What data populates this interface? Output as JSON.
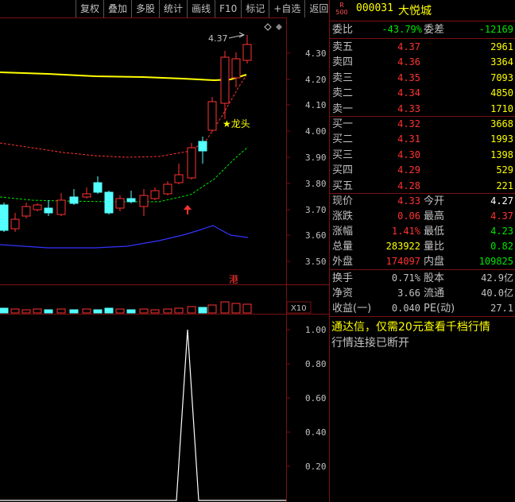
{
  "toolbar": [
    "复权",
    "叠加",
    "多股",
    "统计",
    "画线",
    "F10",
    "标记",
    "+自选",
    "返回"
  ],
  "chart": {
    "price_axis": [
      "4.30",
      "4.20",
      "4.10",
      "4.00",
      "3.90",
      "3.80",
      "3.70",
      "3.60",
      "3.50"
    ],
    "indicator_axis": [
      "1.00",
      "0.80",
      "0.60",
      "0.40",
      "0.20"
    ],
    "high_label": "4.37",
    "dragon_label": "★龙头",
    "hk_badge": "港",
    "volume_tag": "X10",
    "colors": {
      "up": "#ff3232",
      "down": "#54ffff",
      "ma_yellow": "#ffff00",
      "axis": "#7a1010"
    }
  },
  "stock": {
    "badge_r": "R",
    "badge_num": "500",
    "code": "000031",
    "name": "大悦城"
  },
  "order_book": {
    "weibi_label": "委比",
    "weibi_value": "-43.79%",
    "weicha_label": "委差",
    "weicha_value": "-12169",
    "sell": [
      {
        "label": "卖五",
        "price": "4.37",
        "volume": "2961"
      },
      {
        "label": "卖四",
        "price": "4.36",
        "volume": "3364"
      },
      {
        "label": "卖三",
        "price": "4.35",
        "volume": "7093"
      },
      {
        "label": "卖二",
        "price": "4.34",
        "volume": "4850"
      },
      {
        "label": "卖一",
        "price": "4.33",
        "volume": "1710"
      }
    ],
    "buy": [
      {
        "label": "买一",
        "price": "4.32",
        "volume": "3668"
      },
      {
        "label": "买二",
        "price": "4.31",
        "volume": "1993"
      },
      {
        "label": "买三",
        "price": "4.30",
        "volume": "1398"
      },
      {
        "label": "买四",
        "price": "4.29",
        "volume": "529"
      },
      {
        "label": "买五",
        "price": "4.28",
        "volume": "221"
      }
    ]
  },
  "quote": {
    "xianjia_label": "现价",
    "xianjia": "4.33",
    "jinkai_label": "今开",
    "jinkai": "4.27",
    "zhangdie_label": "涨跌",
    "zhangdie": "0.06",
    "zuigao_label": "最高",
    "zuigao": "4.37",
    "zhangfu_label": "涨幅",
    "zhangfu": "1.41%",
    "zuidi_label": "最低",
    "zuidi": "4.23",
    "zongliang_label": "总量",
    "zongliang": "283922",
    "liangbi_label": "量比",
    "liangbi": "0.82",
    "waipan_label": "外盘",
    "waipan": "174097",
    "neipan_label": "内盘",
    "neipan": "109825",
    "huanshou_label": "换手",
    "huanshou": "0.71%",
    "guben_label": "股本",
    "guben": "42.9亿",
    "jingzi_label": "净资",
    "jingzi": "3.66",
    "liutong_label": "流通",
    "liutong": "40.0亿",
    "shouyi_label": "收益(一)",
    "shouyi": "0.040",
    "pe_label": "PE(动)",
    "pe": "27.1"
  },
  "messages": {
    "ad": "通达信，仅需20元查看千档行情",
    "status": "行情连接已断开"
  }
}
